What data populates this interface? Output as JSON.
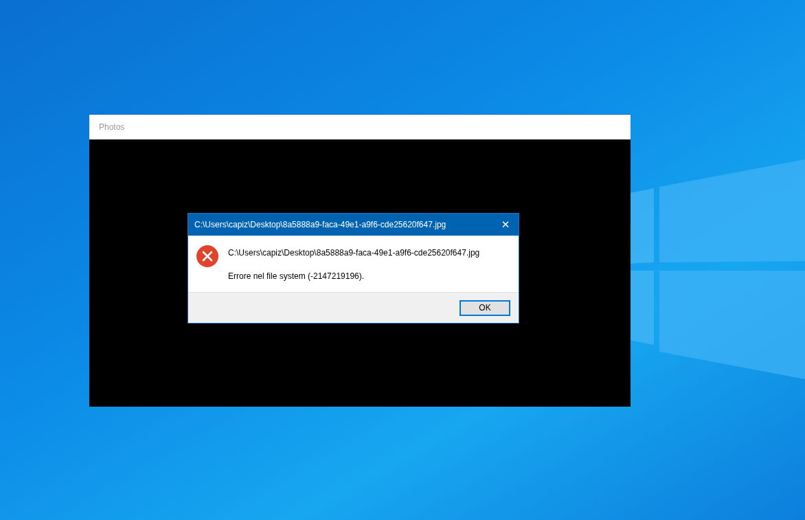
{
  "window": {
    "title": "Photos"
  },
  "dialog": {
    "title": "C:\\Users\\capiz\\Desktop\\8a5888a9-faca-49e1-a9f6-cde25620f647.jpg",
    "close": "✕",
    "message": "C:\\Users\\capiz\\Desktop\\8a5888a9-faca-49e1-a9f6-cde25620f647.jpg",
    "detail": "Errore nel file system (-2147219196).",
    "buttons": [
      {
        "label": "OK",
        "selected": true
      }
    ]
  }
}
